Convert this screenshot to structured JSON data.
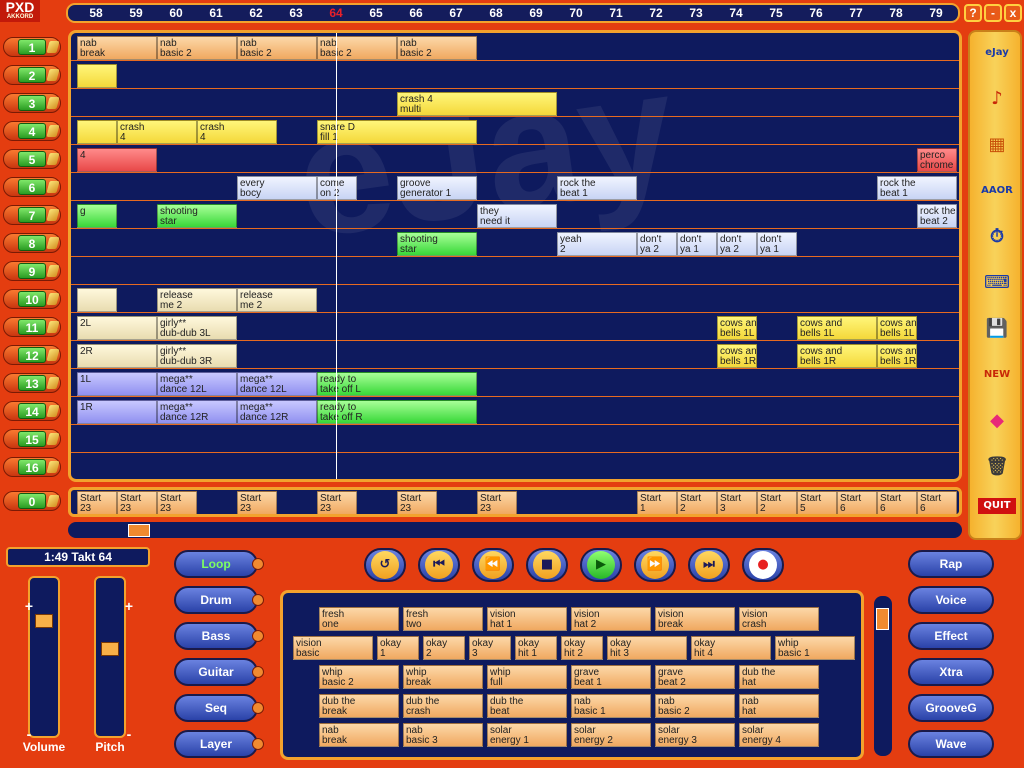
{
  "app": {
    "logo": "PXD",
    "logo_sub": "AKKORD"
  },
  "window_controls": {
    "help": "?",
    "minimize": "-",
    "close": "x"
  },
  "ruler": {
    "ticks": [
      "58",
      "59",
      "60",
      "61",
      "62",
      "63",
      "64",
      "65",
      "66",
      "67",
      "68",
      "69",
      "70",
      "71",
      "72",
      "73",
      "74",
      "75",
      "76",
      "77",
      "78",
      "79"
    ],
    "current": "64"
  },
  "tracks": [
    {
      "label": "1"
    },
    {
      "label": "2"
    },
    {
      "label": "3"
    },
    {
      "label": "4"
    },
    {
      "label": "5"
    },
    {
      "label": "6"
    },
    {
      "label": "7"
    },
    {
      "label": "8"
    },
    {
      "label": "9"
    },
    {
      "label": "10"
    },
    {
      "label": "11"
    },
    {
      "label": "12"
    },
    {
      "label": "13"
    },
    {
      "label": "14"
    },
    {
      "label": "15"
    },
    {
      "label": "16"
    }
  ],
  "track0": {
    "label": "0"
  },
  "arrange_rows": [
    [
      {
        "t": "nab\nbreak",
        "c": "o",
        "s": 0,
        "w": 1
      },
      {
        "t": "nab\nbasic 2",
        "c": "o",
        "s": 1,
        "w": 1
      },
      {
        "t": "nab\nbasic 2",
        "c": "o",
        "s": 2,
        "w": 1
      },
      {
        "t": "nab\nbasic 2",
        "c": "o",
        "s": 3,
        "w": 1
      },
      {
        "t": "nab\nbasic 2",
        "c": "o",
        "s": 4,
        "w": 1
      }
    ],
    [
      {
        "t": "",
        "c": "y",
        "s": 0,
        "w": 0.5
      }
    ],
    [
      {
        "t": "crash 4\nmulti",
        "c": "y",
        "s": 4,
        "w": 2
      }
    ],
    [
      {
        "t": "",
        "c": "y",
        "s": 0,
        "w": 0.5
      },
      {
        "t": "crash\n4",
        "c": "y",
        "s": 0.5,
        "w": 1
      },
      {
        "t": "crash\n4",
        "c": "y",
        "s": 1.5,
        "w": 1
      },
      {
        "t": "snare D\nfill 1",
        "c": "y",
        "s": 3,
        "w": 2
      }
    ],
    [
      {
        "t": "4",
        "c": "r",
        "s": 0,
        "w": 1
      },
      {
        "t": "perco\nchrome",
        "c": "r",
        "s": 10.5,
        "w": 0.5
      }
    ],
    [
      {
        "t": "every\nbocy",
        "c": "w",
        "s": 2,
        "w": 1
      },
      {
        "t": "come\non 2",
        "c": "w",
        "s": 3,
        "w": 0.5
      },
      {
        "t": "groove\ngenerator 1",
        "c": "w",
        "s": 4,
        "w": 1
      },
      {
        "t": "rock the\nbeat 1",
        "c": "w",
        "s": 6,
        "w": 1
      },
      {
        "t": "rock the\nbeat 1",
        "c": "w",
        "s": 10,
        "w": 1
      }
    ],
    [
      {
        "t": "g",
        "c": "g",
        "s": 0,
        "w": 0.5
      },
      {
        "t": "shooting\nstar",
        "c": "g",
        "s": 1,
        "w": 1
      },
      {
        "t": "they\nneed it",
        "c": "w",
        "s": 5,
        "w": 1
      },
      {
        "t": "rock the\nbeat 2",
        "c": "w",
        "s": 10.5,
        "w": 0.5
      }
    ],
    [
      {
        "t": "shooting\nstar",
        "c": "g",
        "s": 4,
        "w": 1
      },
      {
        "t": "yeah\n2",
        "c": "w",
        "s": 6,
        "w": 1
      },
      {
        "t": "don't\nya 2",
        "c": "w",
        "s": 7,
        "w": 0.5
      },
      {
        "t": "don't\nya 1",
        "c": "w",
        "s": 7.5,
        "w": 0.5
      },
      {
        "t": "don't\nya 2",
        "c": "w",
        "s": 8,
        "w": 0.5
      },
      {
        "t": "don't\nya 1",
        "c": "w",
        "s": 8.5,
        "w": 0.5
      }
    ],
    [],
    [
      {
        "t": "",
        "c": "b",
        "s": 0,
        "w": 0.5
      },
      {
        "t": "release\nme 2",
        "c": "b",
        "s": 1,
        "w": 1
      },
      {
        "t": "release\nme 2",
        "c": "b",
        "s": 2,
        "w": 1
      }
    ],
    [
      {
        "t": "2L",
        "c": "b",
        "s": 0,
        "w": 1
      },
      {
        "t": "girly**\ndub-dub 3L",
        "c": "b",
        "s": 1,
        "w": 1
      },
      {
        "t": "cows and\nbells 1L",
        "c": "y",
        "s": 8,
        "w": 0.5
      },
      {
        "t": "cows and\nbells 1L",
        "c": "y",
        "s": 9,
        "w": 1
      },
      {
        "t": "cows and\nbells 1L",
        "c": "y",
        "s": 10,
        "w": 0.5
      }
    ],
    [
      {
        "t": "2R",
        "c": "b",
        "s": 0,
        "w": 1
      },
      {
        "t": "girly**\ndub-dub 3R",
        "c": "b",
        "s": 1,
        "w": 1
      },
      {
        "t": "cows and\nbells 1R",
        "c": "y",
        "s": 8,
        "w": 0.5
      },
      {
        "t": "cows and\nbells 1R",
        "c": "y",
        "s": 9,
        "w": 1
      },
      {
        "t": "cows and\nbells 1R",
        "c": "y",
        "s": 10,
        "w": 0.5
      }
    ],
    [
      {
        "t": "1L",
        "c": "v",
        "s": 0,
        "w": 1
      },
      {
        "t": "mega**\ndance 12L",
        "c": "v",
        "s": 1,
        "w": 1
      },
      {
        "t": "mega**\ndance 12L",
        "c": "v",
        "s": 2,
        "w": 1
      },
      {
        "t": "ready to\ntake off L",
        "c": "g",
        "s": 3,
        "w": 2
      }
    ],
    [
      {
        "t": "1R",
        "c": "v",
        "s": 0,
        "w": 1
      },
      {
        "t": "mega**\ndance 12R",
        "c": "v",
        "s": 1,
        "w": 1
      },
      {
        "t": "mega**\ndance 12R",
        "c": "v",
        "s": 2,
        "w": 1
      },
      {
        "t": "ready to\ntake off R",
        "c": "g",
        "s": 3,
        "w": 2
      }
    ],
    [],
    []
  ],
  "track0_cells": [
    {
      "t": "Start\n23",
      "s": 0
    },
    {
      "t": "Start\n23",
      "s": 1
    },
    {
      "t": "Start\n23",
      "s": 2
    },
    {
      "t": "Start\n23",
      "s": 4
    },
    {
      "t": "Start\n23",
      "s": 6
    },
    {
      "t": "Start\n23",
      "s": 8
    },
    {
      "t": "Start\n23",
      "s": 10
    },
    {
      "t": "Start\n1",
      "s": 14
    },
    {
      "t": "Start\n2",
      "s": 15
    },
    {
      "t": "Start\n3",
      "s": 16
    },
    {
      "t": "Start\n2",
      "s": 17
    },
    {
      "t": "Start\n5",
      "s": 18
    },
    {
      "t": "Start\n6",
      "s": 19
    },
    {
      "t": "Start\n6",
      "s": 20
    },
    {
      "t": "Start\n6",
      "s": 21
    }
  ],
  "time_display": "1:49  Takt 64",
  "sliders": {
    "volume": "Volume",
    "pitch": "Pitch",
    "plus": "+",
    "minus": "-"
  },
  "categories": [
    "Loop",
    "Drum",
    "Bass",
    "Guitar",
    "Seq",
    "Layer"
  ],
  "active_category": "Loop",
  "right_categories": [
    "Rap",
    "Voice",
    "Effect",
    "Xtra",
    "GrooveG",
    "Wave"
  ],
  "transport": [
    "↺",
    "⏮",
    "⏪",
    "■",
    "▶",
    "⏩",
    "⏭",
    "●"
  ],
  "sidebar_icons": [
    "eJay",
    "♪",
    "▦",
    "AAOR",
    "⏱",
    "⌨",
    "💾",
    "NEW",
    "◆",
    "🗑",
    "QUIT"
  ],
  "samples": [
    [
      "fresh\none",
      "fresh\ntwo",
      "vision\nhat 1",
      "vision\nhat 2",
      "vision\nbreak",
      "vision\ncrash"
    ],
    [
      "vision\nbasic",
      "okay\n1",
      "okay\n2",
      "okay\n3",
      "okay\nhit 1",
      "okay\nhit 2",
      "okay\nhit 3",
      "okay\nhit 4",
      "whip\nbasic 1"
    ],
    [
      "whip\nbasic 2",
      "whip\nbreak",
      "whip\nfull",
      "grave\nbeat 1",
      "grave\nbeat 2",
      "dub the\nhat"
    ],
    [
      "dub the\nbreak",
      "dub the\ncrash",
      "dub the\nbeat",
      "nab\nbasic 1",
      "nab\nbasic 2",
      "nab\nhat"
    ],
    [
      "nab\nbreak",
      "nab\nbasic 3",
      "solar\nenergy 1",
      "solar\nenergy 2",
      "solar\nenergy 3",
      "solar\nenergy 4"
    ]
  ]
}
